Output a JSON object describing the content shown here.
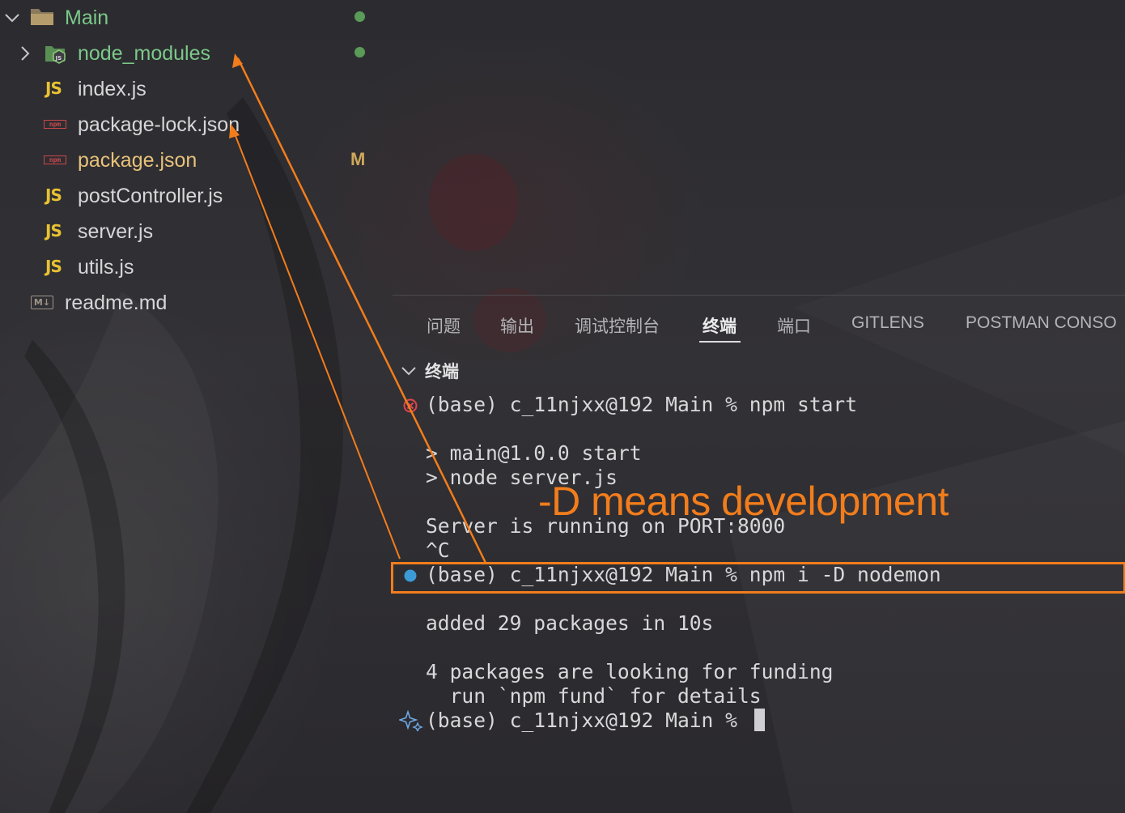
{
  "explorer": {
    "root_folder": {
      "label": "Main",
      "icon": "folder-icon",
      "expanded": true,
      "status": "modified-dot"
    },
    "items": [
      {
        "label": "node_modules",
        "icon": "node-folder-icon",
        "type": "folder",
        "collapsed": true,
        "status": "dot"
      },
      {
        "label": "index.js",
        "icon": "js-icon",
        "icon_text": "JS",
        "type": "file"
      },
      {
        "label": "package-lock.json",
        "icon": "npm-icon",
        "icon_text": "npm",
        "type": "file"
      },
      {
        "label": "package.json",
        "icon": "npm-icon",
        "icon_text": "npm",
        "type": "file",
        "badge": "M"
      },
      {
        "label": "postController.js",
        "icon": "js-icon",
        "icon_text": "JS",
        "type": "file"
      },
      {
        "label": "server.js",
        "icon": "js-icon",
        "icon_text": "JS",
        "type": "file"
      },
      {
        "label": "utils.js",
        "icon": "js-icon",
        "icon_text": "JS",
        "type": "file"
      },
      {
        "label": "readme.md",
        "icon": "markdown-icon",
        "icon_text": "M↓",
        "type": "file"
      }
    ]
  },
  "panel": {
    "tabs": [
      {
        "label": "问题",
        "active": false
      },
      {
        "label": "输出",
        "active": false
      },
      {
        "label": "调试控制台",
        "active": false
      },
      {
        "label": "终端",
        "active": true
      },
      {
        "label": "端口",
        "active": false
      },
      {
        "label": "GITLENS",
        "active": false
      },
      {
        "label": "POSTMAN CONSO",
        "active": false
      }
    ],
    "terminal_title": "终端",
    "terminal_lines": [
      {
        "text": "(base) c_11njxx@192 Main % npm start",
        "marker": "error-circle-icon"
      },
      {
        "text": "> main@1.0.0 start"
      },
      {
        "text": "> node server.js"
      },
      {
        "text": "Server is running on PORT:8000"
      },
      {
        "text": "^C"
      },
      {
        "text": "(base) c_11njxx@192 Main % npm i -D nodemon",
        "marker": "blue-dot-icon"
      },
      {
        "text": "added 29 packages in 10s"
      },
      {
        "text": "4 packages are looking for funding"
      },
      {
        "text": "  run `npm fund` for details"
      },
      {
        "text": "(base) c_11njxx@192 Main % ",
        "marker": "sparkle-icon",
        "cursor": true
      }
    ]
  },
  "annotation": {
    "text": "-D means development",
    "color": "#f27d1c"
  },
  "colors": {
    "folder_green": "#7cc98a",
    "package_json_yellow": "#e8c27a",
    "modified_badge": "#cfa85a",
    "js_yellow": "#e8c232",
    "npm_red": "#c9464b",
    "error_red": "#e0454c",
    "blue_dot": "#3c9bd6"
  }
}
